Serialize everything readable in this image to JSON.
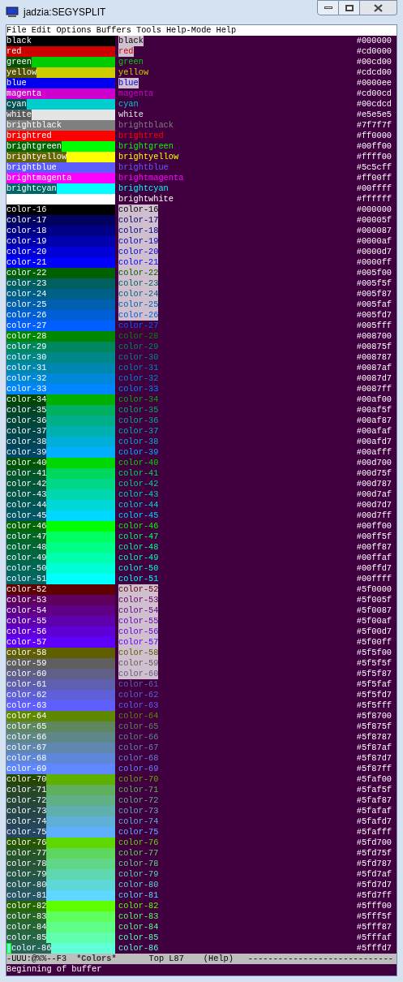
{
  "window": {
    "title": "jadzia:SEGYSPLIT"
  },
  "menu_bar": [
    "File",
    "Edit",
    "Options",
    "Buffers",
    "Tools",
    "Help-Mode",
    "Help"
  ],
  "colors": [
    {
      "swatch": "black",
      "label": "black",
      "hex": "#000000",
      "color": "#000000"
    },
    {
      "swatch": "red",
      "label": "red",
      "hex": "#cd0000",
      "color": "#cd0000"
    },
    {
      "swatch": "green",
      "label": "green",
      "hex": "#00cd00",
      "color": "#00cd00"
    },
    {
      "swatch": "yellow",
      "label": "yellow",
      "hex": "#cdcd00",
      "color": "#cdcd00"
    },
    {
      "swatch": "blue",
      "label": "blue",
      "hex": "#0000ee",
      "color": "#0000ee"
    },
    {
      "swatch": "magenta",
      "label": "magenta",
      "hex": "#cd00cd",
      "color": "#cd00cd"
    },
    {
      "swatch": "cyan",
      "label": "cyan",
      "hex": "#00cdcd",
      "color": "#00cdcd"
    },
    {
      "swatch": "white",
      "label": "white",
      "hex": "#e5e5e5",
      "color": "#e5e5e5"
    },
    {
      "swatch": "brightblack",
      "label": "brightblack",
      "hex": "#7f7f7f",
      "color": "#7f7f7f"
    },
    {
      "swatch": "brightred",
      "label": "brightred",
      "hex": "#ff0000",
      "color": "#ff0000"
    },
    {
      "swatch": "brightgreen",
      "label": "brightgreen",
      "hex": "#00ff00",
      "color": "#00ff00"
    },
    {
      "swatch": "brightyellow",
      "label": "brightyellow",
      "hex": "#ffff00",
      "color": "#ffff00"
    },
    {
      "swatch": "brightblue",
      "label": "brightblue",
      "hex": "#5c5cff",
      "color": "#5c5cff"
    },
    {
      "swatch": "brightmagenta",
      "label": "brightmagenta",
      "hex": "#ff00ff",
      "color": "#ff00ff"
    },
    {
      "swatch": "brightcyan",
      "label": "brightcyan",
      "hex": "#00ffff",
      "color": "#00ffff"
    },
    {
      "label": "brightwhite",
      "hex": "#ffffff",
      "color": "#ffffff"
    },
    {
      "swatch": "color-16",
      "label": "color-16",
      "hex": "#000000",
      "color": "#000000"
    },
    {
      "swatch": "color-17",
      "label": "color-17",
      "hex": "#00005f",
      "color": "#00005f"
    },
    {
      "swatch": "color-18",
      "label": "color-18",
      "hex": "#000087",
      "color": "#000087"
    },
    {
      "swatch": "color-19",
      "label": "color-19",
      "hex": "#0000af",
      "color": "#0000af"
    },
    {
      "swatch": "color-20",
      "label": "color-20",
      "hex": "#0000d7",
      "color": "#0000d7"
    },
    {
      "swatch": "color-21",
      "label": "color-21",
      "hex": "#0000ff",
      "color": "#0000ff"
    },
    {
      "swatch": "color-22",
      "label": "color-22",
      "hex": "#005f00",
      "color": "#005f00"
    },
    {
      "swatch": "color-23",
      "label": "color-23",
      "hex": "#005f5f",
      "color": "#005f5f"
    },
    {
      "swatch": "color-24",
      "label": "color-24",
      "hex": "#005f87",
      "color": "#005f87"
    },
    {
      "swatch": "color-25",
      "label": "color-25",
      "hex": "#005faf",
      "color": "#005faf"
    },
    {
      "swatch": "color-26",
      "label": "color-26",
      "hex": "#005fd7",
      "color": "#005fd7"
    },
    {
      "swatch": "color-27",
      "label": "color-27",
      "hex": "#005fff",
      "color": "#005fff"
    },
    {
      "swatch": "color-28",
      "label": "color-28",
      "hex": "#008700",
      "color": "#008700"
    },
    {
      "swatch": "color-29",
      "label": "color-29",
      "hex": "#00875f",
      "color": "#00875f"
    },
    {
      "swatch": "color-30",
      "label": "color-30",
      "hex": "#008787",
      "color": "#008787"
    },
    {
      "swatch": "color-31",
      "label": "color-31",
      "hex": "#0087af",
      "color": "#0087af"
    },
    {
      "swatch": "color-32",
      "label": "color-32",
      "hex": "#0087d7",
      "color": "#0087d7"
    },
    {
      "swatch": "color-33",
      "label": "color-33",
      "hex": "#0087ff",
      "color": "#0087ff"
    },
    {
      "swatch": "color-34",
      "label": "color-34",
      "hex": "#00af00",
      "color": "#00af00"
    },
    {
      "swatch": "color-35",
      "label": "color-35",
      "hex": "#00af5f",
      "color": "#00af5f"
    },
    {
      "swatch": "color-36",
      "label": "color-36",
      "hex": "#00af87",
      "color": "#00af87"
    },
    {
      "swatch": "color-37",
      "label": "color-37",
      "hex": "#00afaf",
      "color": "#00afaf"
    },
    {
      "swatch": "color-38",
      "label": "color-38",
      "hex": "#00afd7",
      "color": "#00afd7"
    },
    {
      "swatch": "color-39",
      "label": "color-39",
      "hex": "#00afff",
      "color": "#00afff"
    },
    {
      "swatch": "color-40",
      "label": "color-40",
      "hex": "#00d700",
      "color": "#00d700"
    },
    {
      "swatch": "color-41",
      "label": "color-41",
      "hex": "#00d75f",
      "color": "#00d75f"
    },
    {
      "swatch": "color-42",
      "label": "color-42",
      "hex": "#00d787",
      "color": "#00d787"
    },
    {
      "swatch": "color-43",
      "label": "color-43",
      "hex": "#00d7af",
      "color": "#00d7af"
    },
    {
      "swatch": "color-44",
      "label": "color-44",
      "hex": "#00d7d7",
      "color": "#00d7d7"
    },
    {
      "swatch": "color-45",
      "label": "color-45",
      "hex": "#00d7ff",
      "color": "#00d7ff"
    },
    {
      "swatch": "color-46",
      "label": "color-46",
      "hex": "#00ff00",
      "color": "#00ff00"
    },
    {
      "swatch": "color-47",
      "label": "color-47",
      "hex": "#00ff5f",
      "color": "#00ff5f"
    },
    {
      "swatch": "color-48",
      "label": "color-48",
      "hex": "#00ff87",
      "color": "#00ff87"
    },
    {
      "swatch": "color-49",
      "label": "color-49",
      "hex": "#00ffaf",
      "color": "#00ffaf"
    },
    {
      "swatch": "color-50",
      "label": "color-50",
      "hex": "#00ffd7",
      "color": "#00ffd7"
    },
    {
      "swatch": "color-51",
      "label": "color-51",
      "hex": "#00ffff",
      "color": "#00ffff"
    },
    {
      "swatch": "color-52",
      "label": "color-52",
      "hex": "#5f0000",
      "color": "#5f0000"
    },
    {
      "swatch": "color-53",
      "label": "color-53",
      "hex": "#5f005f",
      "color": "#5f005f"
    },
    {
      "swatch": "color-54",
      "label": "color-54",
      "hex": "#5f0087",
      "color": "#5f0087"
    },
    {
      "swatch": "color-55",
      "label": "color-55",
      "hex": "#5f00af",
      "color": "#5f00af"
    },
    {
      "swatch": "color-56",
      "label": "color-56",
      "hex": "#5f00d7",
      "color": "#5f00d7"
    },
    {
      "swatch": "color-57",
      "label": "color-57",
      "hex": "#5f00ff",
      "color": "#5f00ff"
    },
    {
      "swatch": "color-58",
      "label": "color-58",
      "hex": "#5f5f00",
      "color": "#5f5f00"
    },
    {
      "swatch": "color-59",
      "label": "color-59",
      "hex": "#5f5f5f",
      "color": "#5f5f5f"
    },
    {
      "swatch": "color-60",
      "label": "color-60",
      "hex": "#5f5f87",
      "color": "#5f5f87"
    },
    {
      "swatch": "color-61",
      "label": "color-61",
      "hex": "#5f5faf",
      "color": "#5f5faf"
    },
    {
      "swatch": "color-62",
      "label": "color-62",
      "hex": "#5f5fd7",
      "color": "#5f5fd7"
    },
    {
      "swatch": "color-63",
      "label": "color-63",
      "hex": "#5f5fff",
      "color": "#5f5fff"
    },
    {
      "swatch": "color-64",
      "label": "color-64",
      "hex": "#5f8700",
      "color": "#5f8700"
    },
    {
      "swatch": "color-65",
      "label": "color-65",
      "hex": "#5f875f",
      "color": "#5f875f"
    },
    {
      "swatch": "color-66",
      "label": "color-66",
      "hex": "#5f8787",
      "color": "#5f8787"
    },
    {
      "swatch": "color-67",
      "label": "color-67",
      "hex": "#5f87af",
      "color": "#5f87af"
    },
    {
      "swatch": "color-68",
      "label": "color-68",
      "hex": "#5f87d7",
      "color": "#5f87d7"
    },
    {
      "swatch": "color-69",
      "label": "color-69",
      "hex": "#5f87ff",
      "color": "#5f87ff"
    },
    {
      "swatch": "color-70",
      "label": "color-70",
      "hex": "#5faf00",
      "color": "#5faf00"
    },
    {
      "swatch": "color-71",
      "label": "color-71",
      "hex": "#5faf5f",
      "color": "#5faf5f"
    },
    {
      "swatch": "color-72",
      "label": "color-72",
      "hex": "#5faf87",
      "color": "#5faf87"
    },
    {
      "swatch": "color-73",
      "label": "color-73",
      "hex": "#5fafaf",
      "color": "#5fafaf"
    },
    {
      "swatch": "color-74",
      "label": "color-74",
      "hex": "#5fafd7",
      "color": "#5fafd7"
    },
    {
      "swatch": "color-75",
      "label": "color-75",
      "hex": "#5fafff",
      "color": "#5fafff"
    },
    {
      "swatch": "color-76",
      "label": "color-76",
      "hex": "#5fd700",
      "color": "#5fd700"
    },
    {
      "swatch": "color-77",
      "label": "color-77",
      "hex": "#5fd75f",
      "color": "#5fd75f"
    },
    {
      "swatch": "color-78",
      "label": "color-78",
      "hex": "#5fd787",
      "color": "#5fd787"
    },
    {
      "swatch": "color-79",
      "label": "color-79",
      "hex": "#5fd7af",
      "color": "#5fd7af"
    },
    {
      "swatch": "color-80",
      "label": "color-80",
      "hex": "#5fd7d7",
      "color": "#5fd7d7"
    },
    {
      "swatch": "color-81",
      "label": "color-81",
      "hex": "#5fd7ff",
      "color": "#5fd7ff"
    },
    {
      "swatch": "color-82",
      "label": "color-82",
      "hex": "#5fff00",
      "color": "#5fff00"
    },
    {
      "swatch": "color-83",
      "label": "color-83",
      "hex": "#5fff5f",
      "color": "#5fff5f"
    },
    {
      "swatch": "color-84",
      "label": "color-84",
      "hex": "#5fff87",
      "color": "#5fff87"
    },
    {
      "swatch": "color-85",
      "label": "color-85",
      "hex": "#5fffaf",
      "color": "#5fffaf"
    },
    {
      "swatch": "color-86",
      "label": "color-86",
      "hex": "#5fffd7",
      "color": "#5fffd7"
    }
  ],
  "mode_line": {
    "status": "-UUU:@%%--F3",
    "buffer": "*Colors*",
    "position": "Top L87",
    "mode": "(Help)",
    "fill": "-----------------------------"
  },
  "echo_area": "Beginning of buffer"
}
